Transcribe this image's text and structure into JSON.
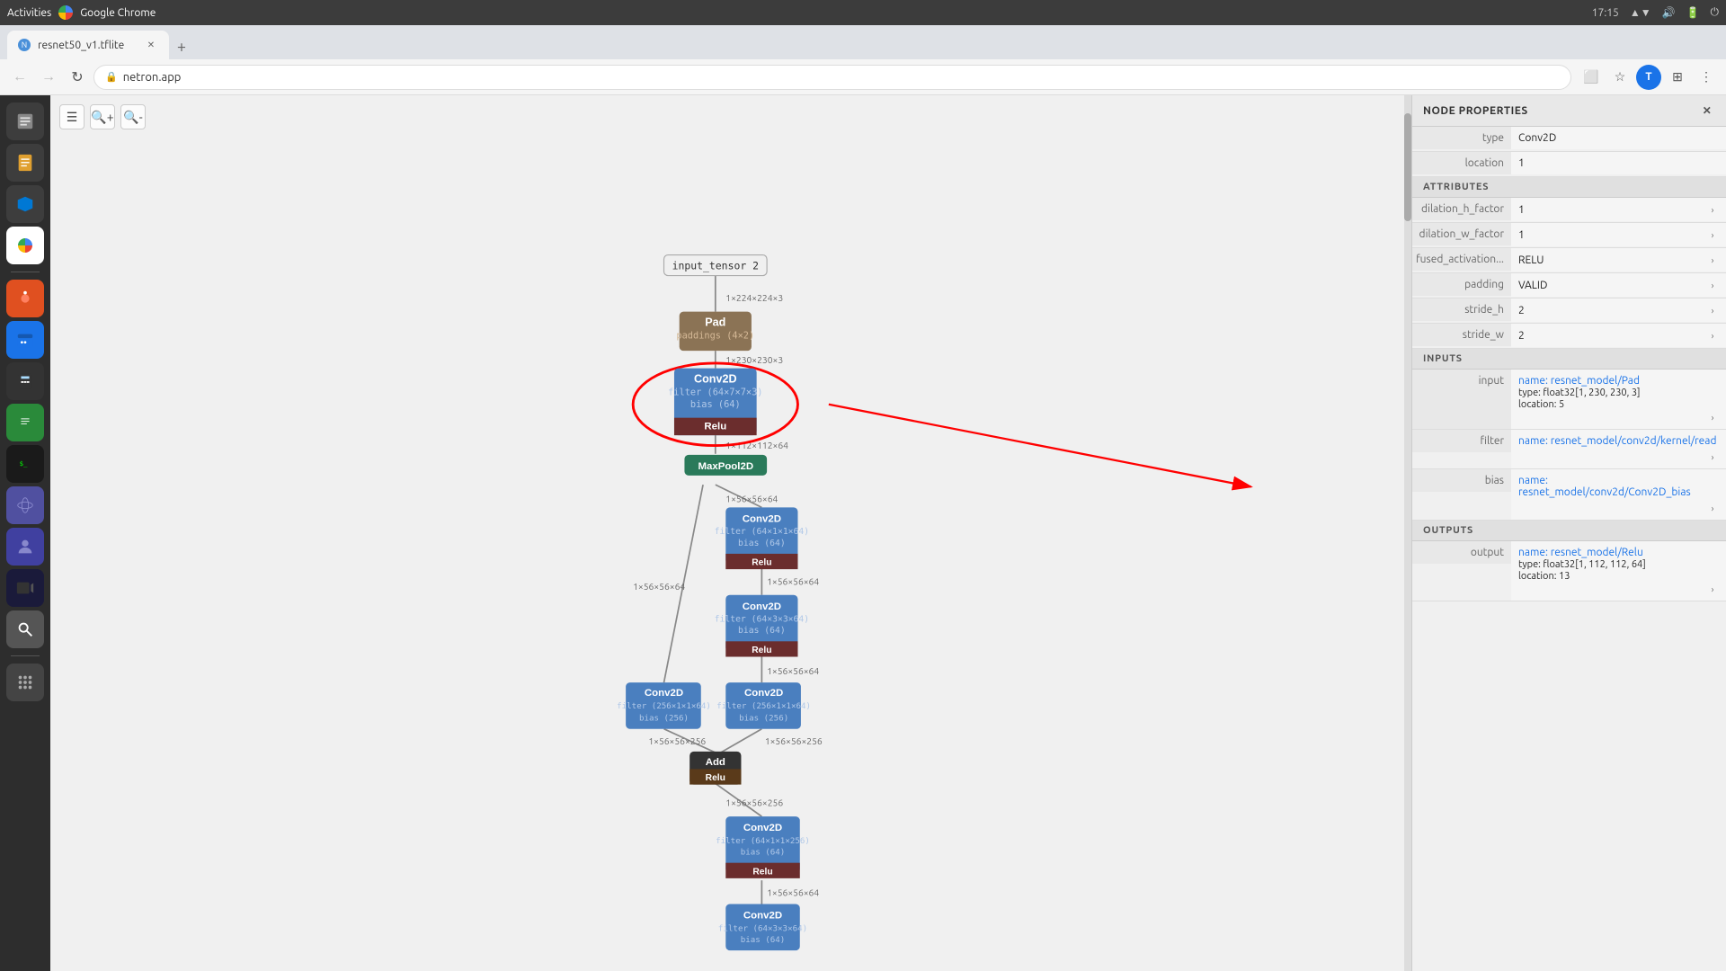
{
  "titlebar": {
    "activities": "Activities",
    "app_name": "Google Chrome",
    "time": "17:15",
    "sys_icons": [
      "network",
      "volume",
      "battery",
      "power"
    ]
  },
  "browser": {
    "tab_label": "resnet50_v1.tflite",
    "url": "netron.app",
    "nav": {
      "back_disabled": true,
      "forward_disabled": true,
      "refresh": true
    }
  },
  "toolbar": {
    "buttons": [
      "menu",
      "zoom-in",
      "zoom-out"
    ]
  },
  "graph": {
    "nodes": [
      {
        "id": "input",
        "type": "input",
        "label": "input_tensor 2"
      },
      {
        "id": "pad",
        "type": "pad",
        "label": "Pad",
        "detail": "paddings (4×2)"
      },
      {
        "id": "conv2d_1",
        "type": "conv2d",
        "label": "Conv2D",
        "filter": "(64×7×7×3)",
        "bias": "(64)",
        "relu": "Relu"
      },
      {
        "id": "maxpool",
        "type": "maxpool",
        "label": "MaxPool2D"
      },
      {
        "id": "conv2d_2",
        "type": "conv2d",
        "label": "Conv2D",
        "filter": "(64×1×1×64)",
        "bias": "(64)",
        "relu": "Relu"
      },
      {
        "id": "conv2d_3",
        "type": "conv2d",
        "label": "Conv2D",
        "filter": "(64×3×3×64)",
        "bias": "(64)",
        "relu": "Relu"
      },
      {
        "id": "conv2d_4a",
        "type": "conv2d",
        "label": "Conv2D",
        "filter": "(256×1×1×64)",
        "bias": "(256)"
      },
      {
        "id": "conv2d_4b",
        "type": "conv2d",
        "label": "Conv2D",
        "filter": "(256×1×1×64)",
        "bias": "(256)"
      },
      {
        "id": "add",
        "type": "add",
        "label": "Add",
        "relu": "Relu"
      },
      {
        "id": "conv2d_5",
        "type": "conv2d",
        "label": "Conv2D",
        "filter": "(64×1×1×256)",
        "bias": "(64)",
        "relu": "Relu"
      },
      {
        "id": "conv2d_6",
        "type": "conv2d",
        "label": "Conv2D",
        "filter": "(64×3×3×64)",
        "bias": "(64)"
      }
    ],
    "edges": [
      {
        "from": "input",
        "to": "pad",
        "label": "1×224×224×3"
      },
      {
        "from": "pad",
        "to": "conv2d_1",
        "label": "1×230×230×3"
      },
      {
        "from": "conv2d_1",
        "to": "maxpool",
        "label": "1×112×112×64"
      },
      {
        "from": "maxpool",
        "to": "conv2d_2",
        "label": "1×56×56×64"
      },
      {
        "from": "maxpool",
        "to": "conv2d_4a",
        "label": "1×56×56×64"
      },
      {
        "from": "conv2d_2",
        "to": "conv2d_3",
        "label": "1×56×56×64"
      },
      {
        "from": "conv2d_3",
        "to": "conv2d_4b",
        "label": "1×56×56×64"
      },
      {
        "from": "conv2d_4a",
        "to": "add",
        "label": "1×56×56×256"
      },
      {
        "from": "conv2d_4b",
        "to": "add",
        "label": "1×56×56×256"
      },
      {
        "from": "add",
        "to": "conv2d_5",
        "label": "1×56×56×256"
      },
      {
        "from": "conv2d_5",
        "to": "conv2d_6",
        "label": "1×56×56×64"
      },
      {
        "from": "conv2d_6",
        "to": "next",
        "label": "1×56×56×64"
      }
    ]
  },
  "properties": {
    "title": "NODE PROPERTIES",
    "type_label": "type",
    "type_value": "Conv2D",
    "location_label": "location",
    "location_value": "1",
    "attributes_title": "ATTRIBUTES",
    "attributes": [
      {
        "label": "dilation_h_factor",
        "value": "1",
        "expandable": true
      },
      {
        "label": "dilation_w_factor",
        "value": "1",
        "expandable": true
      },
      {
        "label": "fused_activation...",
        "value": "RELU",
        "expandable": true
      },
      {
        "label": "padding",
        "value": "VALID",
        "expandable": true
      },
      {
        "label": "stride_h",
        "value": "2",
        "expandable": true
      },
      {
        "label": "stride_w",
        "value": "2",
        "expandable": true
      }
    ],
    "inputs_title": "INPUTS",
    "inputs": [
      {
        "label": "input",
        "name": "name: resnet_model/Pad",
        "type": "type: float32[1, 230, 230, 3]",
        "location": "location: 5",
        "expandable": true
      },
      {
        "label": "filter",
        "name": "name: resnet_model/conv2d/kernel/read",
        "expandable": true
      },
      {
        "label": "bias",
        "name": "name: resnet_model/conv2d/Conv2D_bias",
        "expandable": true
      }
    ],
    "outputs_title": "OUTPUTS",
    "outputs": [
      {
        "label": "output",
        "name": "name: resnet_model/Relu",
        "type": "type: float32[1, 112, 112, 64]",
        "location": "location: 13",
        "expandable": true
      }
    ]
  },
  "os_sidebar": {
    "icons": [
      {
        "name": "files",
        "symbol": "📁"
      },
      {
        "name": "text-editor",
        "symbol": "📝"
      },
      {
        "name": "vscode",
        "symbol": "🔵"
      },
      {
        "name": "chrome",
        "symbol": "🌐"
      },
      {
        "name": "ubuntu-software",
        "symbol": "🟠"
      },
      {
        "name": "calendar",
        "symbol": "📅"
      },
      {
        "name": "calculator",
        "symbol": "🧮"
      },
      {
        "name": "libreoffice",
        "symbol": "📊"
      },
      {
        "name": "terminal",
        "symbol": "⬛"
      },
      {
        "name": "ubuntu-globe",
        "symbol": "🌍"
      },
      {
        "name": "teams",
        "symbol": "🟣"
      },
      {
        "name": "video",
        "symbol": "🎬"
      },
      {
        "name": "search",
        "symbol": "🔍"
      },
      {
        "name": "apps",
        "symbol": "⋮⋮⋮"
      }
    ]
  }
}
